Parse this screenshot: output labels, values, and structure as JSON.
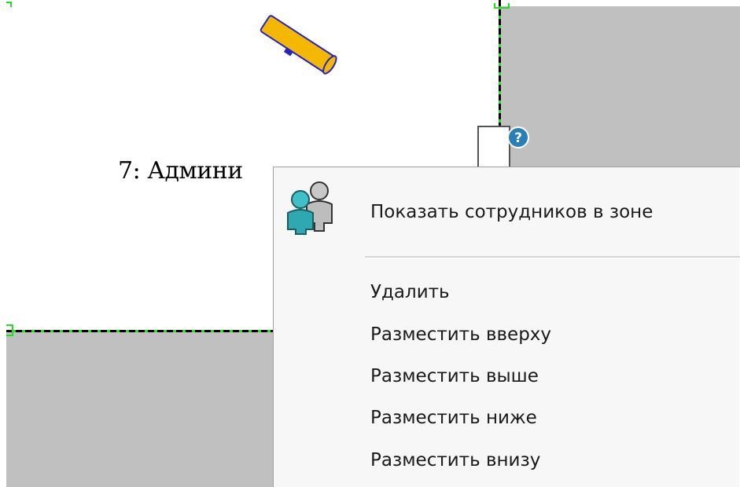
{
  "zone": {
    "label": "7: Админи"
  },
  "context_menu": {
    "items": [
      {
        "label": "Показать сотрудников в зоне",
        "icon": "employees-group-icon"
      },
      {
        "label": "Удалить"
      },
      {
        "label": "Разместить вверху"
      },
      {
        "label": "Разместить выше"
      },
      {
        "label": "Разместить ниже"
      },
      {
        "label": "Разместить внизу"
      }
    ]
  },
  "colors": {
    "background_outside": "#c0c0c0",
    "zone_background": "#ffffff",
    "zone_border_dash": "#000000",
    "zone_border_accent": "#22dd22",
    "menu_background": "#f7f7f7",
    "camera_body": "#f5b800",
    "camera_outline": "#2222cc",
    "help_badge": "#2a7fb8"
  }
}
